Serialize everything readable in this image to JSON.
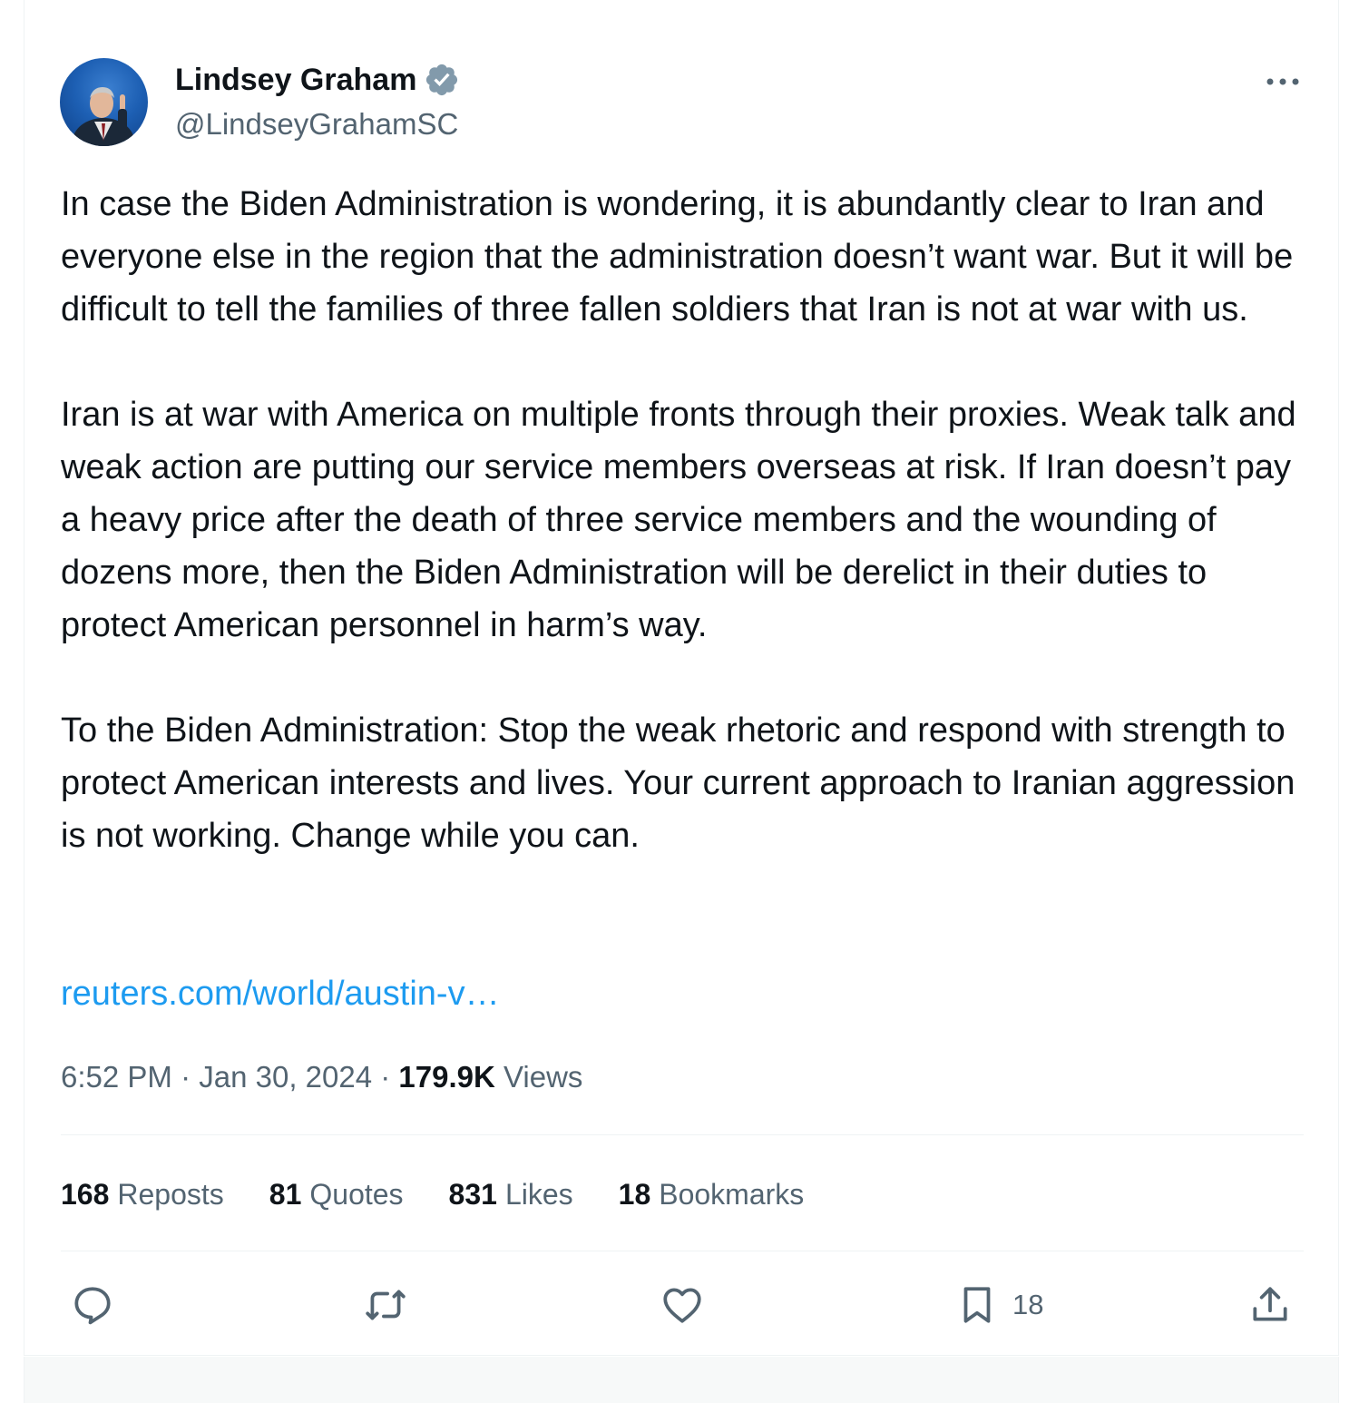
{
  "author": {
    "name": "Lindsey Graham",
    "handle": "@LindseyGrahamSC",
    "verified_color": "#829aab"
  },
  "tweet": {
    "paragraphs": [
      "In case the Biden Administration is wondering, it is abundantly clear to Iran and everyone else in the region that the administration doesn’t want war. But it will be difficult to tell the families of three fallen soldiers that Iran is not at war with us.",
      "Iran is at war with America on multiple fronts through their proxies. Weak talk and weak action are putting our service members overseas at risk. If Iran doesn’t pay a heavy price after the death of three service members and the wounding of dozens more, then the Biden Administration will be derelict in their duties to protect American personnel in harm’s way.",
      "To the Biden Administration: Stop the weak rhetoric and respond with strength to protect American interests and lives. Your current approach to Iranian aggression is not working. Change while you can."
    ],
    "link_text": "reuters.com/world/austin-v…"
  },
  "meta": {
    "time": "6:52 PM",
    "separator": " · ",
    "date": "Jan 30, 2024",
    "views_count": "179.9K",
    "views_label": "Views"
  },
  "stats": [
    {
      "count": "168",
      "label": "Reposts"
    },
    {
      "count": "81",
      "label": "Quotes"
    },
    {
      "count": "831",
      "label": "Likes"
    },
    {
      "count": "18",
      "label": "Bookmarks"
    }
  ],
  "actions": {
    "reply_icon": "reply-icon",
    "repost_icon": "repost-icon",
    "like_icon": "heart-icon",
    "bookmark_icon": "bookmark-icon",
    "bookmark_count": "18",
    "share_icon": "share-icon"
  },
  "colors": {
    "link": "#1d9bf0",
    "secondary_text": "#536471",
    "primary_text": "#0f1419"
  }
}
